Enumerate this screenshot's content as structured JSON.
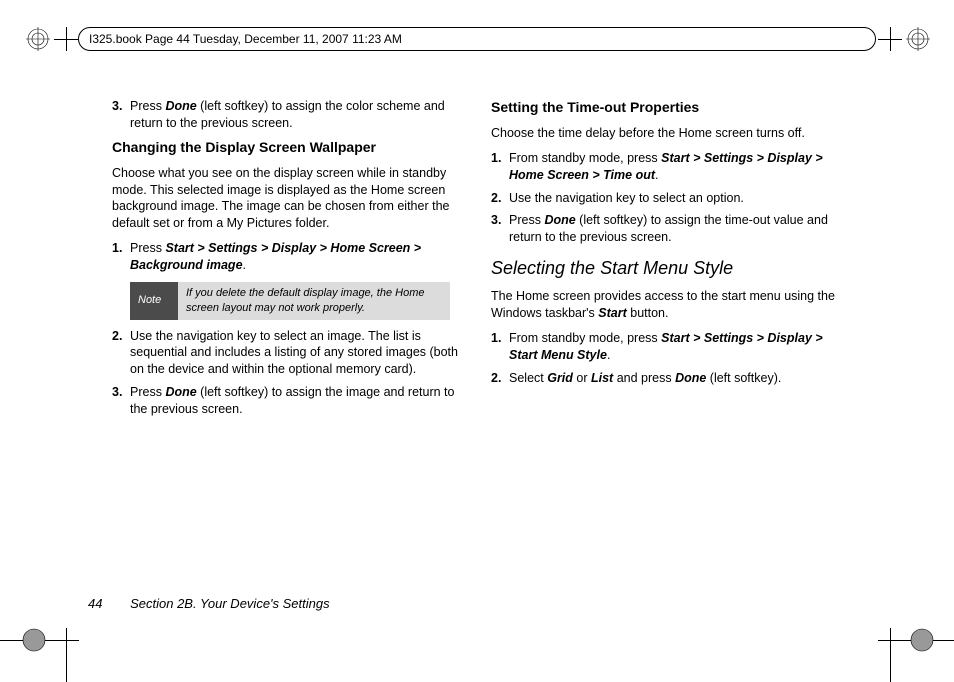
{
  "header": "I325.book  Page 44  Tuesday, December 11, 2007  11:23 AM",
  "left": {
    "li3_a": "Press ",
    "li3_done": "Done",
    "li3_b": " (left softkey) to assign the color scheme and return to the previous screen.",
    "h_wall": "Changing the Display Screen Wallpaper",
    "wall_body": "Choose what you see on the display screen while in standby mode. This selected image is displayed as the Home screen background image. The image can be chosen from either the default set or from a My Pictures folder.",
    "li1_a": "Press ",
    "li1_path": "Start > Settings > Display > Home Screen > Background image",
    "li1_b": ".",
    "note_label": "Note",
    "note_text": "If you delete the default display image, the Home screen layout may not work properly.",
    "li2": "Use the navigation key to select an image. The list is sequential and includes a listing of any stored images (both on the device and within the optional memory card).",
    "li3b_a": "Press ",
    "li3b_done": "Done",
    "li3b_b": " (left softkey) to assign the image and return to the previous screen."
  },
  "right": {
    "h_timeout": "Setting the Time-out Properties",
    "timeout_body": "Choose the time delay before the Home screen turns off.",
    "t_li1_a": "From standby mode, press ",
    "t_li1_path": "Start > Settings > Display > Home Screen > Time out",
    "t_li1_b": ".",
    "t_li2": "Use the navigation key to select an option.",
    "t_li3_a": "Press ",
    "t_li3_done": "Done",
    "t_li3_b": " (left softkey) to assign the time-out value and return to the previous screen.",
    "h_start": "Selecting the Start Menu Style",
    "start_body_a": "The Home screen provides access to the start menu using the Windows taskbar's ",
    "start_body_b": "Start",
    "start_body_c": " button.",
    "s_li1_a": "From standby mode, press ",
    "s_li1_path": "Start > Settings > Display > Start Menu Style",
    "s_li1_b": ".",
    "s_li2_a": "Select ",
    "s_li2_grid": "Grid",
    "s_li2_b": " or ",
    "s_li2_list": "List",
    "s_li2_c": " and press ",
    "s_li2_done": "Done",
    "s_li2_d": " (left softkey)."
  },
  "footer": {
    "page": "44",
    "section": "Section 2B. Your Device's Settings"
  },
  "nums": {
    "n1": "1.",
    "n2": "2.",
    "n3": "3."
  }
}
